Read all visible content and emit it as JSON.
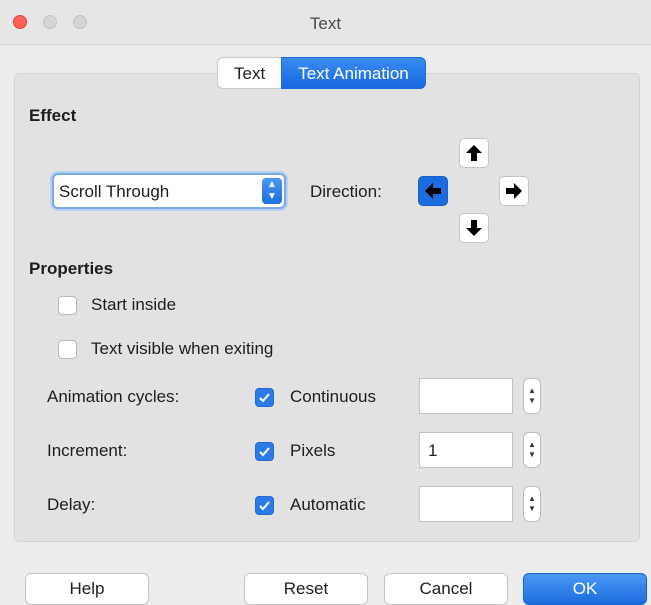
{
  "window": {
    "title": "Text"
  },
  "tabs": [
    {
      "label": "Text",
      "active": false
    },
    {
      "label": "Text Animation",
      "active": true
    }
  ],
  "effect": {
    "heading": "Effect",
    "effect_value": "Scroll Through",
    "direction_label": "Direction:",
    "directions": [
      {
        "name": "up",
        "icon": "arrow-up-icon",
        "selected": false
      },
      {
        "name": "left",
        "icon": "arrow-left-icon",
        "selected": true
      },
      {
        "name": "right",
        "icon": "arrow-right-icon",
        "selected": false
      },
      {
        "name": "down",
        "icon": "arrow-down-icon",
        "selected": false
      }
    ]
  },
  "properties": {
    "heading": "Properties",
    "start_inside": {
      "label": "Start inside",
      "checked": false
    },
    "text_visible_exiting": {
      "label": "Text visible when exiting",
      "checked": false
    },
    "rows": [
      {
        "label": "Animation cycles:",
        "check_label": "Continuous",
        "checked": true,
        "value": ""
      },
      {
        "label": "Increment:",
        "check_label": "Pixels",
        "checked": true,
        "value": "1"
      },
      {
        "label": "Delay:",
        "check_label": "Automatic",
        "checked": true,
        "value": ""
      }
    ]
  },
  "buttons": {
    "help": "Help",
    "reset": "Reset",
    "cancel": "Cancel",
    "ok": "OK"
  },
  "colors": {
    "accent": "#1a6cdf",
    "close_light": "#fe5f57"
  }
}
